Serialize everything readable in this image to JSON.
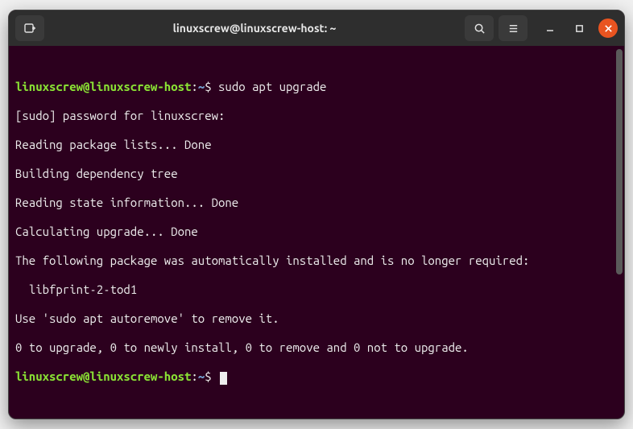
{
  "window": {
    "title": "linuxscrew@linuxscrew-host: ~"
  },
  "prompt": {
    "user_host": "linuxscrew@linuxscrew-host",
    "path": "~",
    "symbol": "$",
    "colon": ":"
  },
  "terminal": {
    "command1": "sudo apt upgrade",
    "lines": [
      "[sudo] password for linuxscrew:",
      "Reading package lists... Done",
      "Building dependency tree",
      "Reading state information... Done",
      "Calculating upgrade... Done",
      "The following package was automatically installed and is no longer required:",
      "  libfprint-2-tod1",
      "Use 'sudo apt autoremove' to remove it.",
      "0 to upgrade, 0 to newly install, 0 to remove and 0 not to upgrade."
    ]
  }
}
